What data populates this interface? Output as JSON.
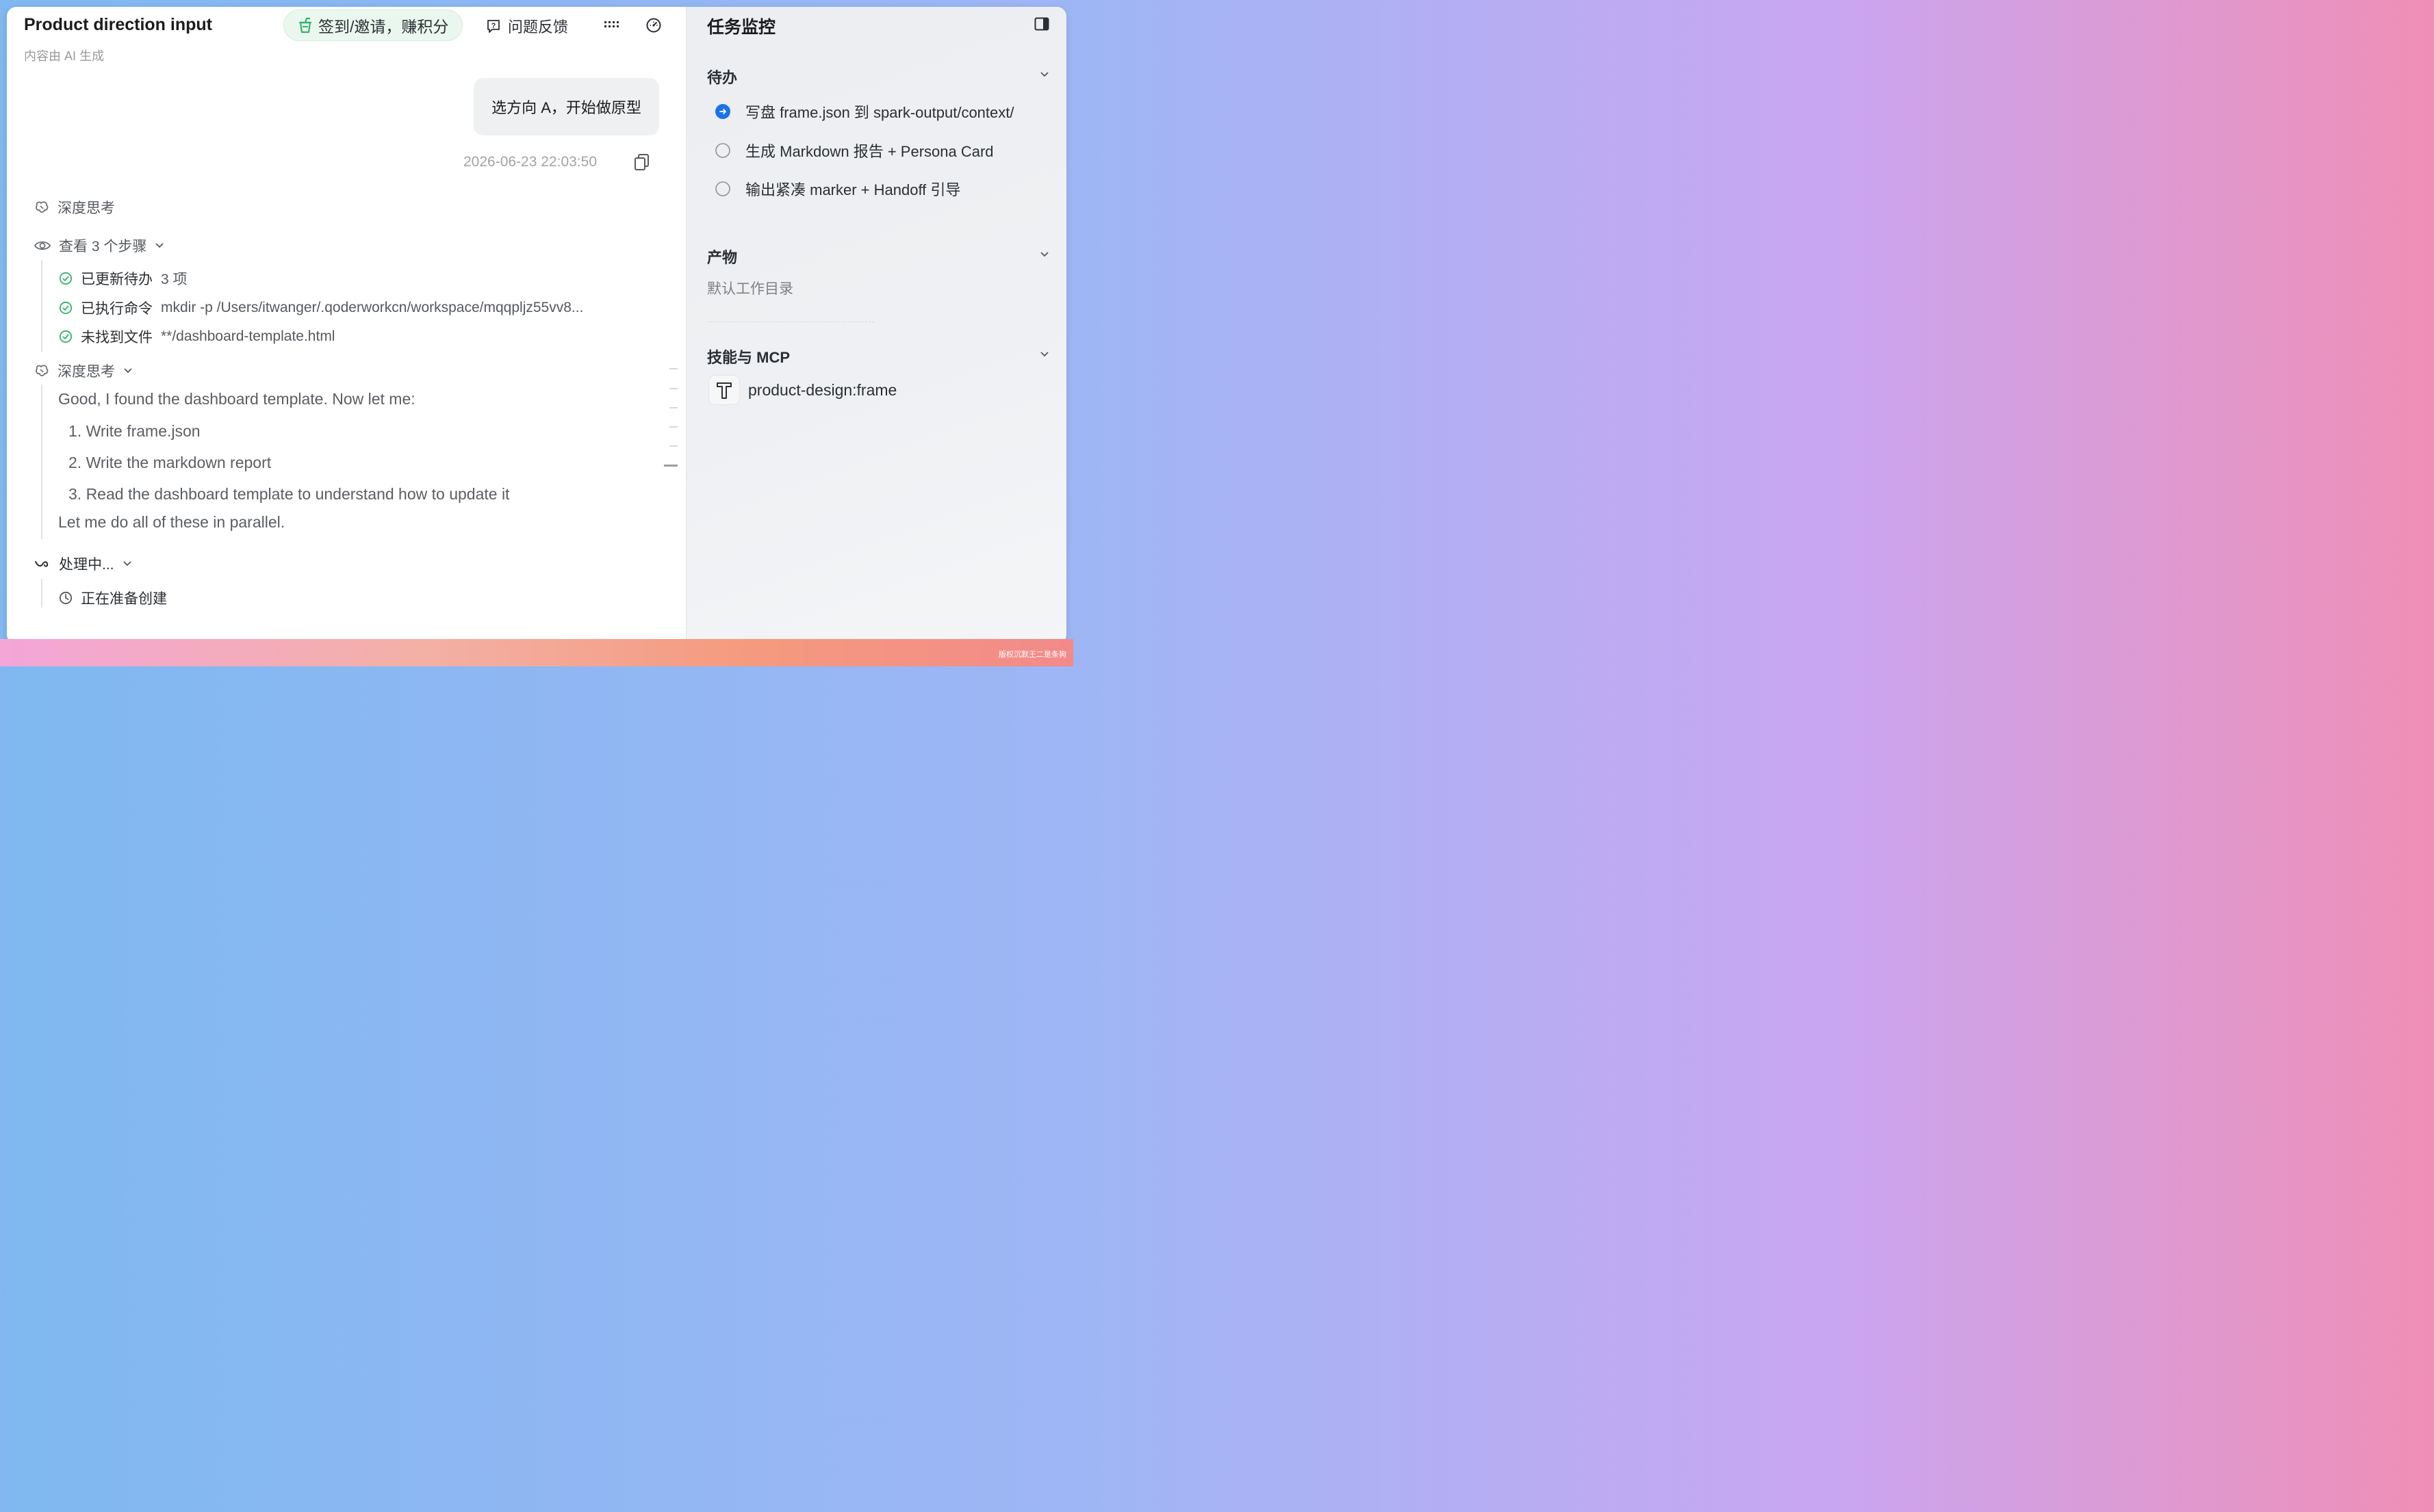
{
  "app": {
    "title": "Product direction input",
    "subtitle": "内容由 AI 生成"
  },
  "toolbar": {
    "invite_label": "签到/邀请，赚积分",
    "feedback_label": "问题反馈"
  },
  "chat": {
    "user_message": "选方向 A，开始做原型",
    "timestamp": "2026-06-23 22:03:50",
    "deep_think_1": "深度思考",
    "view_steps": "查看 3 个步骤",
    "steps": [
      {
        "label": "已更新待办",
        "detail": "3 项"
      },
      {
        "label": "已执行命令",
        "detail": "mkdir -p /Users/itwanger/.qoderworkcn/workspace/mqqpljz55vv8..."
      },
      {
        "label": "未找到文件",
        "detail": "**/dashboard-template.html"
      }
    ],
    "deep_think_2": "深度思考",
    "thinking": {
      "intro": "Good, I found the dashboard template. Now let me:",
      "items": [
        "1. Write frame.json",
        "2. Write the markdown report",
        "3. Read the dashboard template to understand how to update it"
      ],
      "outro": "Let me do all of these in parallel."
    },
    "processing": "处理中...",
    "processing_step": "正在准备创建"
  },
  "sidebar": {
    "title": "任务监控",
    "todo": {
      "heading": "待办",
      "items": [
        {
          "label": "写盘 frame.json 到 spark-output/context/",
          "state": "active"
        },
        {
          "label": "生成 Markdown 报告 + Persona Card",
          "state": "pending"
        },
        {
          "label": "输出紧凑 marker + Handoff 引导",
          "state": "pending"
        }
      ]
    },
    "outputs": {
      "heading": "产物",
      "empty_text": "默认工作目录"
    },
    "skills": {
      "heading": "技能与 MCP",
      "items": [
        {
          "name": "product-design:frame"
        }
      ]
    }
  },
  "watermark": "版权沉默王二是条狗",
  "colors": {
    "accent": "#1a73e8",
    "success": "#34b36a",
    "invite_bg": "#eaf7ef"
  }
}
